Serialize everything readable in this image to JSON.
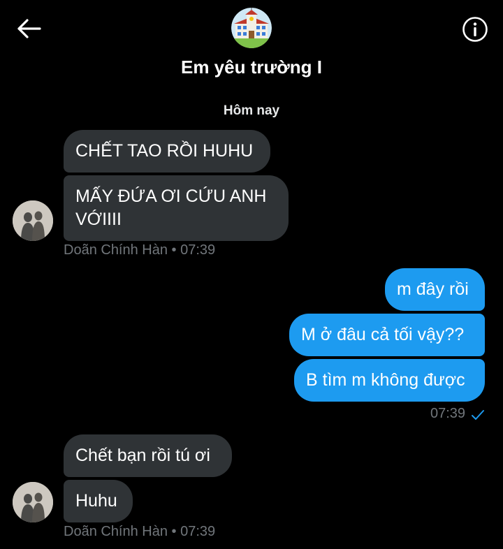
{
  "header": {
    "title": "Em yêu trường I",
    "back_icon": "arrow-left-icon",
    "info_icon": "info-circle-icon"
  },
  "date_separator": "Hôm nay",
  "messages": [
    {
      "text": "CHẾT TAO RỒI HUHU",
      "direction": "incoming"
    },
    {
      "text": "MẤY ĐỨA ƠI CỨU ANH VỚIIII",
      "direction": "incoming"
    },
    {
      "text": "m đây rồi",
      "direction": "outgoing"
    },
    {
      "text": "M ở đâu cả tối vậy??",
      "direction": "outgoing"
    },
    {
      "text": "B tìm m không được",
      "direction": "outgoing"
    },
    {
      "text": "Chết bạn rồi tú ơi",
      "direction": "incoming"
    },
    {
      "text": "Huhu",
      "direction": "incoming"
    }
  ],
  "meta": {
    "group1": "Doãn Chính Hàn • 07:39",
    "outgoing": "07:39",
    "group2": "Doãn Chính Hàn • 07:39"
  },
  "colors": {
    "background": "#000000",
    "incoming_bubble": "#2f3336",
    "outgoing_bubble": "#1d9bf0",
    "meta_text": "#71767b",
    "check": "#1d9bf0"
  }
}
